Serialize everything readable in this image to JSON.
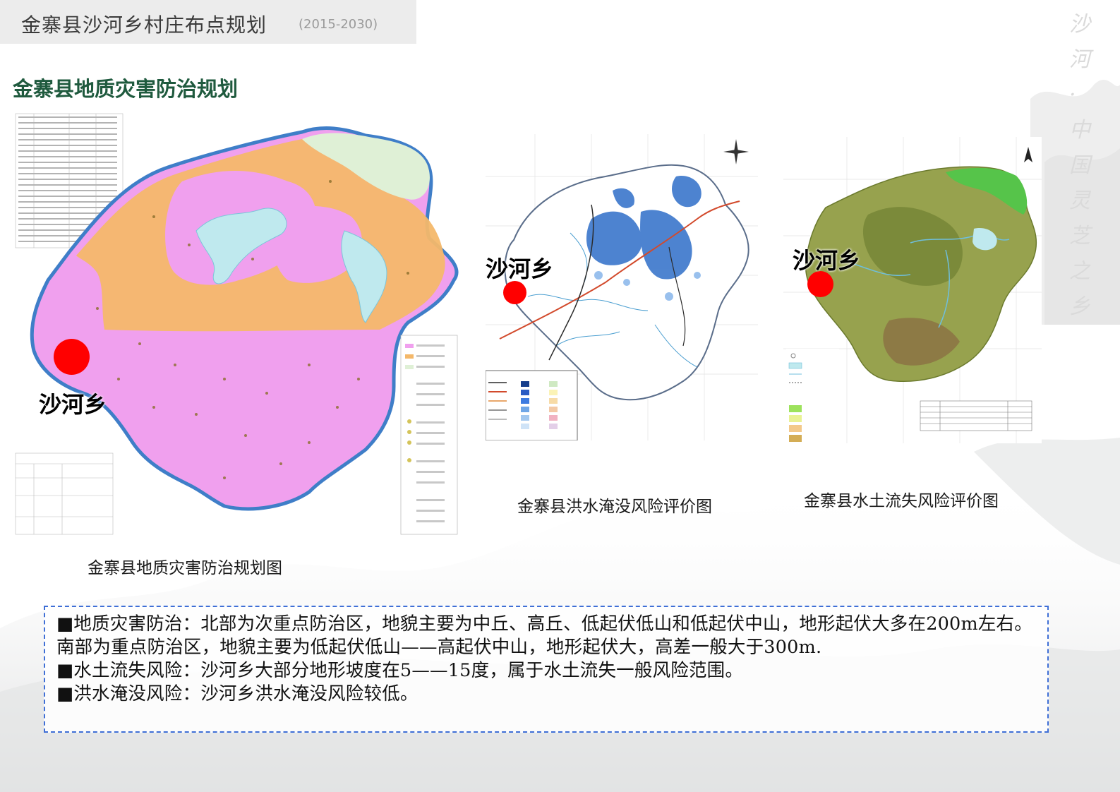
{
  "header": {
    "title": "金寨县沙河乡村庄布点规划",
    "years": "(2015-2030)"
  },
  "section_title": "金寨县地质灾害防治规划",
  "vertical_text": "沙河·中国灵芝之乡",
  "maps": {
    "geo": {
      "caption": "金寨县地质灾害防治规划图",
      "pin_label": "沙河乡"
    },
    "flood": {
      "caption": "金寨县洪水淹没风险评价图",
      "pin_label": "沙河乡"
    },
    "soil": {
      "caption": "金寨县水土流失风险评价图",
      "pin_label": "沙河乡"
    }
  },
  "colors": {
    "pin": "#ff0000",
    "title_green": "#1f5a3e",
    "box_border": "#3f6fd6"
  },
  "description": [
    "■地质灾害防治：北部为次重点防治区，地貌主要为中丘、高丘、低起伏低山和低起伏中山，地形起伏大多在200m左右。南部为重点防治区，地貌主要为低起伏低山——高起伏中山，地形起伏大，高差一般大于300m.",
    "■水土流失风险：沙河乡大部分地形坡度在5——15度，属于水土流失一般风险范围。",
    "■洪水淹没风险：沙河乡洪水淹没风险较低。"
  ]
}
